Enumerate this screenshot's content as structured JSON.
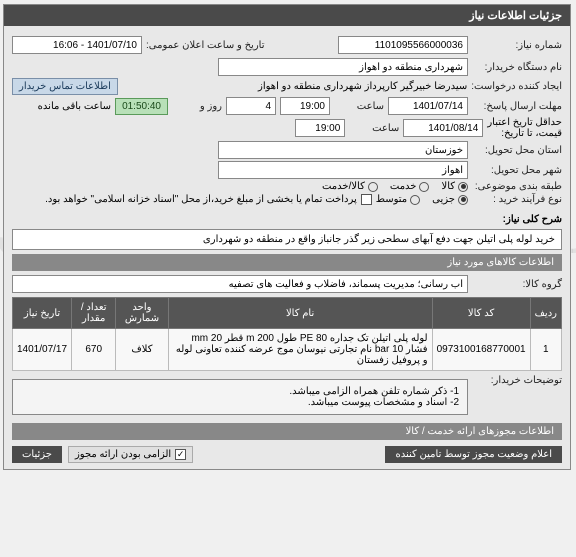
{
  "header": {
    "title": "جزئیات اطلاعات نیاز"
  },
  "fields": {
    "need_no_label": "شماره نیاز:",
    "need_no": "1101095566000036",
    "announce_label": "تاریخ و ساعت اعلان عمومی:",
    "announce": "1401/07/10 - 16:06",
    "buyer_label": "نام دستگاه خریدار:",
    "buyer": "شهرداری منطقه دو اهواز",
    "creator_label": "ایجاد کننده درخواست:",
    "creator": "سیدرضا خبیرگیر کارپرداز  شهرداری منطقه دو اهواز",
    "contact_btn": "اطلاعات تماس خریدار",
    "deadline_reply_label": "مهلت ارسال پاسخ:",
    "deadline_date": "1401/07/14",
    "time_label": "ساعت",
    "deadline_time": "19:00",
    "day_label": "روز و",
    "days": "4",
    "remaining_label": "ساعت باقی مانده",
    "remaining": "01:50:40",
    "min_valid_label": "حداقل تاریخ اعتبار",
    "min_valid_sub": "قیمت، تا تاریخ:",
    "valid_date": "1401/08/14",
    "valid_time": "19:00",
    "province_label": "استان محل تحویل:",
    "province": "خوزستان",
    "city_label": "شهر محل تحویل:",
    "city": "اهواز",
    "category_label": "طبقه بندی موضوعی:",
    "cat_goods": "کالا",
    "cat_service": "خدمت",
    "cat_goods_service": "کالا/خدمت",
    "process_label": "نوع فرآیند خرید :",
    "proc_partial": "جزیی",
    "proc_medium": "متوسط",
    "payment_note": "پرداخت تمام یا بخشی از مبلغ خرید،از محل \"اسناد خزانه اسلامی\" خواهد بود."
  },
  "desc": {
    "label": "شرح کلی نیاز:",
    "text": "خرید لوله پلی اتیلن جهت دفع آبهای سطحی زیر گذر جانباز واقع در منطقه دو شهرداری"
  },
  "items_header": "اطلاعات کالاهای مورد نیاز",
  "group": {
    "label": "گروه کالا:",
    "text": "آب رسانی؛ مدیریت پسماند، فاضلاب و فعالیت های تصفیه"
  },
  "table": {
    "cols": {
      "row": "ردیف",
      "code": "کد کالا",
      "name": "نام کالا",
      "unit": "واحد شمارش",
      "qty": "تعداد / مقدار",
      "date": "تاریخ نیاز"
    },
    "rows": [
      {
        "row": "1",
        "code": "0973100168770001",
        "name": "لوله پلی اتیلن تک جداره PE 80 طول 200 m قطر 20 mm فشار 10 bar نام تجارتی نیوسان موج عرضه کننده تعاونی لوله و پروفیل زفستان",
        "unit": "کلاف",
        "qty": "670",
        "date": "1401/07/17"
      }
    ]
  },
  "notes": {
    "label": "توضیحات خریدار:",
    "line1": "1- ذکر شماره تلفن همراه الزامی میباشد.",
    "line2": "2- اسناد و مشخصات پیوست میباشد."
  },
  "permits_header": "اطلاعات مجوزهای ارائه خدمت / کالا",
  "footer": {
    "right": "اعلام وضعیت مجوز توسط تامین کننده",
    "mandatory": "الزامی بودن ارائه مجوز",
    "details": "جزئیات"
  },
  "mandatory_check": true
}
